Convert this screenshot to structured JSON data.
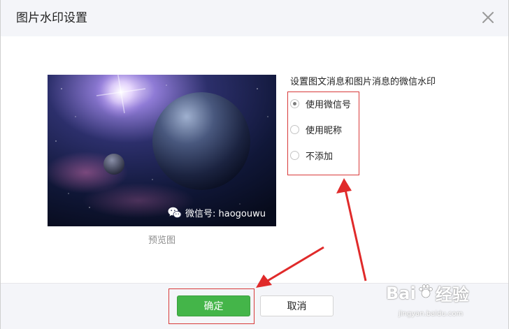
{
  "dialog": {
    "title": "图片水印设置",
    "close_icon": "close-icon"
  },
  "preview": {
    "watermark_text": "微信号: haogouwu",
    "watermark_icon": "wechat-icon",
    "caption": "预览图"
  },
  "options": {
    "title": "设置图文消息和图片消息的微信水印",
    "items": [
      {
        "label": "使用微信号",
        "checked": true
      },
      {
        "label": "使用昵称",
        "checked": false
      },
      {
        "label": "不添加",
        "checked": false
      }
    ]
  },
  "footer": {
    "ok_label": "确定",
    "cancel_label": "取消"
  },
  "badge": {
    "brand": "Bai",
    "brand_tail": "经验",
    "url": "jingyan.baidu.com"
  },
  "colors": {
    "primary_button": "#44b549",
    "annotation_red": "#d83a3a"
  }
}
